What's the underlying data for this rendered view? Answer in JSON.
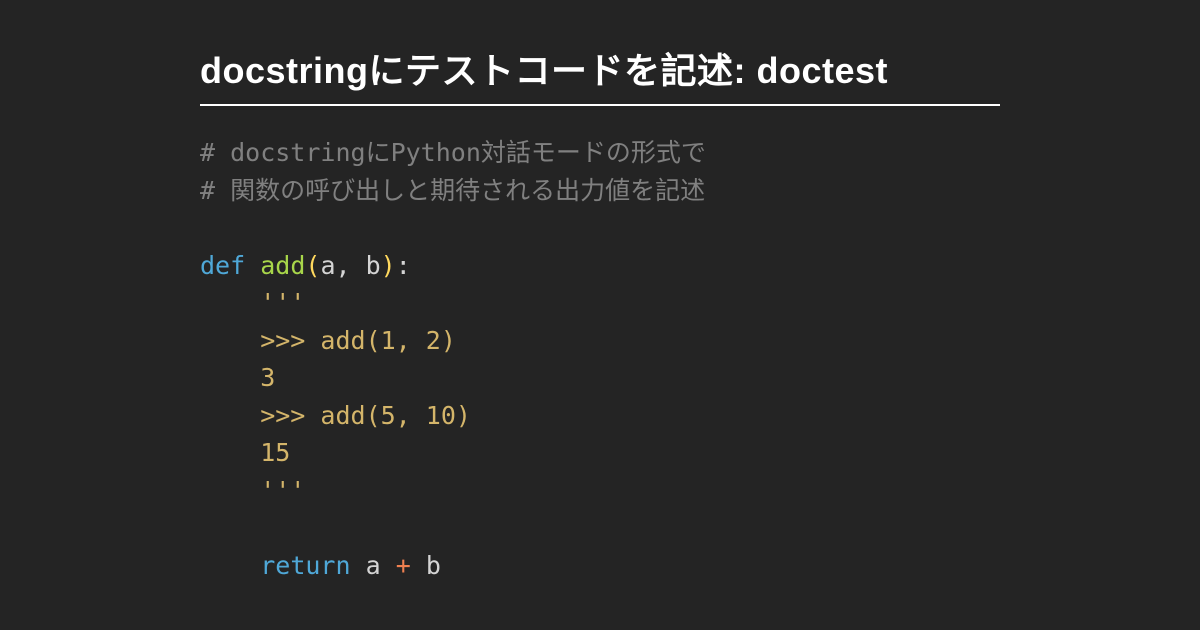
{
  "title": "docstringにテストコードを記述: doctest",
  "code": {
    "comment1": "# docstringにPython対話モードの形式で",
    "comment2": "# 関数の呼び出しと期待される出力値を記述",
    "def": "def",
    "func": "add",
    "lparen": "(",
    "params": "a, b",
    "rparen": ")",
    "colon": ":",
    "docstring_open": "    '''",
    "doc_line1": "    >>> add(1, 2)",
    "doc_line2": "    3",
    "doc_line3": "    >>> add(5, 10)",
    "doc_line4": "    15",
    "docstring_close": "    '''",
    "return_kw": "return",
    "return_a": "a",
    "return_op": "+",
    "return_b": "b"
  }
}
